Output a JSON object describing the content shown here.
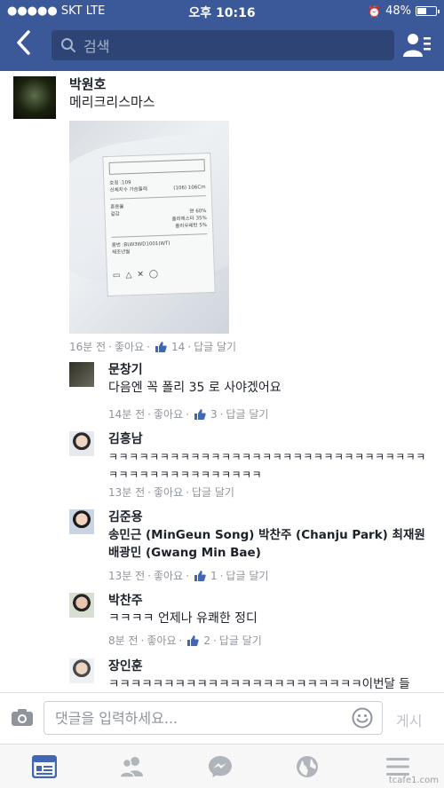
{
  "status_bar": {
    "carrier": "●●●●● SKT  LTE",
    "time": "오후 10:16",
    "battery": "48%",
    "battery_level": 0.48
  },
  "header": {
    "search_placeholder": "검색"
  },
  "post": {
    "author": "박원호",
    "text": "메리크리스마스",
    "meta": {
      "time": "16분 전",
      "like": "좋아요",
      "like_count": "14",
      "reply": "답글 달기"
    },
    "photo_label": {
      "code": "호칭 :109",
      "size": "신체치수 가슴둘레",
      "size_val": "(106) 106Cm",
      "rows": [
        [
          "혼용율",
          ""
        ],
        [
          "겉감",
          "면 60%"
        ],
        [
          "",
          "폴리에스터 35%"
        ],
        [
          "",
          "폴리우레탄 5%"
        ]
      ],
      "product": "품번 :BLW3WD1001(WT)",
      "maker": "제조년월"
    }
  },
  "replies": [
    {
      "name": "문창기",
      "text": "다음엔 꼭 폴리 35 로 사야겠어요",
      "time": "14분 전",
      "like": "좋아요",
      "like_count": "3",
      "reply": "답글 달기"
    },
    {
      "name": "김흥남",
      "text": "ㅋㅋㅋㅋㅋㅋㅋㅋㅋㅋㅋㅋㅋㅋㅋㅋㅋㅋㅋㅋㅋㅋㅋㅋㅋㅋㅋㅋㅋㅋㅋㅋㅋㅋㅋㅋㅋㅋㅋㅋㅋㅋㅋㅋㅋㅋ",
      "time": "13분 전",
      "like": "좋아요",
      "reply": "답글 달기"
    },
    {
      "name": "김준용",
      "text": "송민근 (MinGeun Song) 박찬주 (Chanju Park) 최재원 배광민 (Gwang Min Bae)",
      "time": "13분 전",
      "like": "좋아요",
      "like_count": "1",
      "reply": "답글 달기"
    },
    {
      "name": "박찬주",
      "text": "ㅋㅋㅋㅋ 언제나 유쾌한 정디",
      "time": "8분 전",
      "like": "좋아요",
      "like_count": "2",
      "reply": "답글 달기"
    },
    {
      "name": "장인훈",
      "text": "ㅋㅋㅋㅋㅋㅋㅋㅋㅋㅋㅋㅋㅋㅋㅋㅋㅋㅋㅋㅋㅋㅋㅋ이번달 들"
    }
  ],
  "composer": {
    "placeholder": "댓글을 입력하세요...",
    "post_label": "게시"
  },
  "tabs": [
    {
      "icon": "news-feed-icon"
    },
    {
      "icon": "friends-icon"
    },
    {
      "icon": "messenger-icon"
    },
    {
      "icon": "globe-icon"
    },
    {
      "icon": "menu-icon"
    }
  ],
  "watermark": "tcafe1.com",
  "colors": {
    "brand_blue": "#3b5998",
    "search_bg": "#2d4475",
    "meta_gray": "#90949c",
    "active_tab": "#4267b2"
  }
}
